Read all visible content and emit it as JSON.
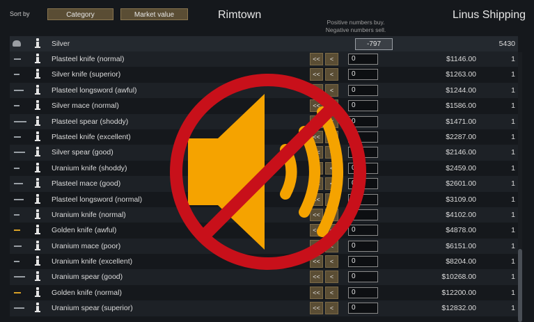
{
  "header": {
    "sort_by_label": "Sort by",
    "sort_buttons": [
      "Category",
      "Market value"
    ],
    "colony_name": "Rimtown",
    "trader_name": "Linus Shipping",
    "hint_line1": "Positive numbers buy.",
    "hint_line2": "Negative numbers sell."
  },
  "silver_row": {
    "icon": "silver-stack-icon",
    "label": "Silver",
    "amount": "-797",
    "trader_count": "5430"
  },
  "buttons": {
    "decrease_all": "<<",
    "decrease_one": "<"
  },
  "items": [
    {
      "name": "Plasteel knife (normal)",
      "qty": "0",
      "price": "$1146.00",
      "count": "1",
      "icon_color": "gray"
    },
    {
      "name": "Silver knife (superior)",
      "qty": "0",
      "price": "$1263.00",
      "count": "1",
      "icon_color": "gray"
    },
    {
      "name": "Plasteel longsword (awful)",
      "qty": "0",
      "price": "$1244.00",
      "count": "1",
      "icon_color": "gray"
    },
    {
      "name": "Silver mace (normal)",
      "qty": "0",
      "price": "$1586.00",
      "count": "1",
      "icon_color": "gray"
    },
    {
      "name": "Plasteel spear (shoddy)",
      "qty": "0",
      "price": "$1471.00",
      "count": "1",
      "icon_color": "gray"
    },
    {
      "name": "Plasteel knife (excellent)",
      "qty": "0",
      "price": "$2287.00",
      "count": "1",
      "icon_color": "gray"
    },
    {
      "name": "Silver spear (good)",
      "qty": "0",
      "price": "$2146.00",
      "count": "1",
      "icon_color": "gray"
    },
    {
      "name": "Uranium knife (shoddy)",
      "qty": "0",
      "price": "$2459.00",
      "count": "1",
      "icon_color": "gray"
    },
    {
      "name": "Plasteel mace (good)",
      "qty": "0",
      "price": "$2601.00",
      "count": "1",
      "icon_color": "gray"
    },
    {
      "name": "Plasteel longsword (normal)",
      "qty": "0",
      "price": "$3109.00",
      "count": "1",
      "icon_color": "gray"
    },
    {
      "name": "Uranium knife (normal)",
      "qty": "0",
      "price": "$4102.00",
      "count": "1",
      "icon_color": "gray"
    },
    {
      "name": "Golden knife (awful)",
      "qty": "0",
      "price": "$4878.00",
      "count": "1",
      "icon_color": "gold"
    },
    {
      "name": "Uranium mace (poor)",
      "qty": "0",
      "price": "$6151.00",
      "count": "1",
      "icon_color": "gray"
    },
    {
      "name": "Uranium knife (excellent)",
      "qty": "0",
      "price": "$8204.00",
      "count": "1",
      "icon_color": "gray"
    },
    {
      "name": "Uranium spear (good)",
      "qty": "0",
      "price": "$10268.00",
      "count": "1",
      "icon_color": "gray"
    },
    {
      "name": "Golden knife (normal)",
      "qty": "0",
      "price": "$12200.00",
      "count": "1",
      "icon_color": "gold"
    },
    {
      "name": "Uranium spear (superior)",
      "qty": "0",
      "price": "$12832.00",
      "count": "1",
      "icon_color": "gray"
    }
  ],
  "overlay": {
    "icon": "muted-speaker-icon",
    "speaker_color": "#f5a300",
    "prohibition_color": "#c8101a"
  }
}
